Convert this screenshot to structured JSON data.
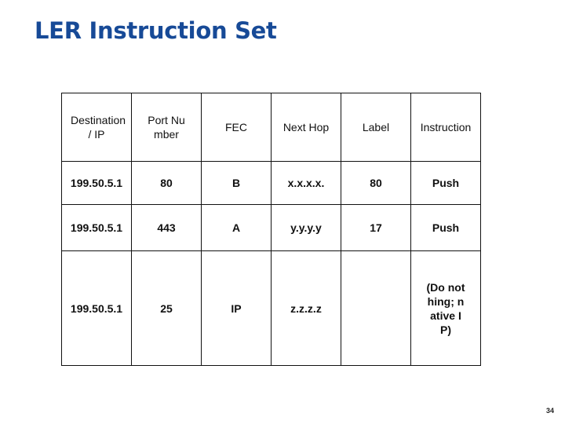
{
  "slide": {
    "title": "LER Instruction Set",
    "page_number": "34"
  },
  "table": {
    "headers": [
      "Destination / IP",
      "Port Number",
      "FEC",
      "Next Hop",
      "Label",
      "Instruction"
    ],
    "rows": [
      [
        "199.50.5.1",
        "80",
        "B",
        "x.x.x.x.",
        "80",
        "Push"
      ],
      [
        "199.50.5.1",
        "443",
        "A",
        "y.y.y.y",
        "17",
        "Push"
      ],
      [
        "199.50.5.1",
        "25",
        "IP",
        "z.z.z.z",
        "",
        "(Do nothing; native IP)"
      ]
    ]
  }
}
